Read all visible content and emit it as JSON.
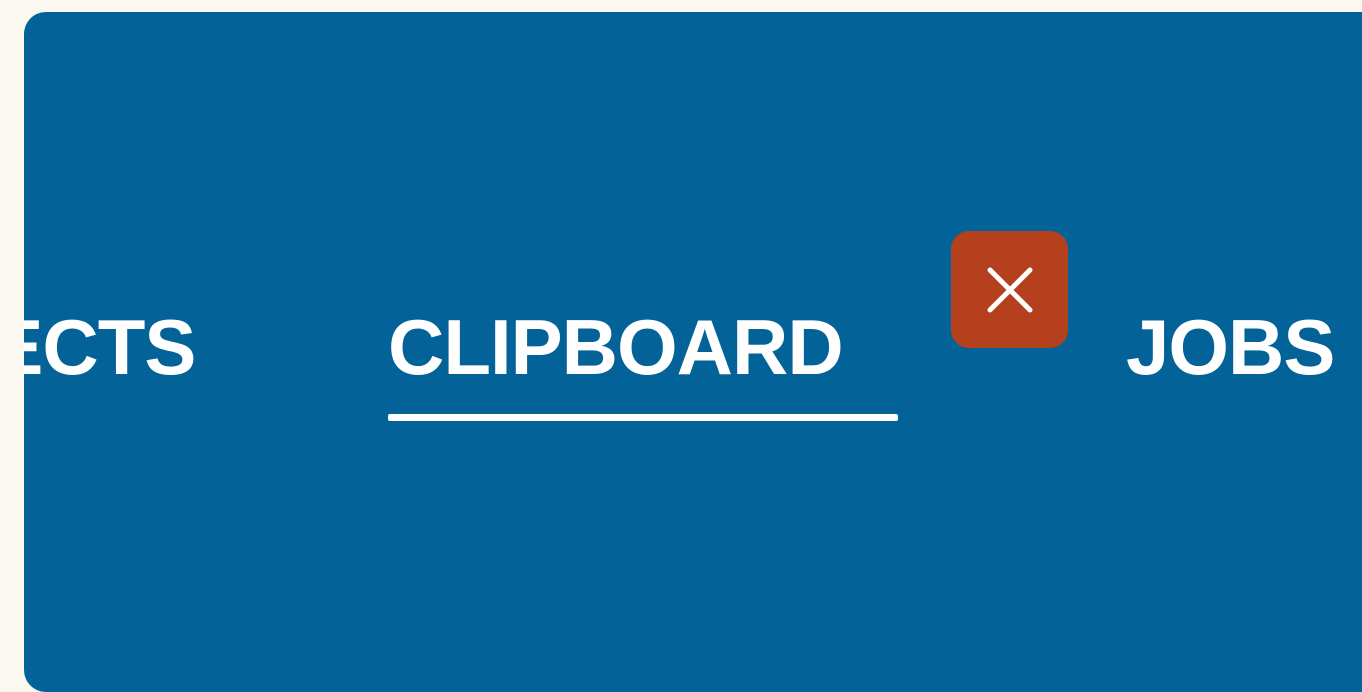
{
  "tabs": [
    {
      "label": "OBJECTS",
      "visible_label": "ECTS",
      "active": false
    },
    {
      "label": "CLIPBOARD",
      "active": true
    },
    {
      "label": "JOBS",
      "active": false
    }
  ],
  "close_button": {
    "icon": "close-icon"
  },
  "colors": {
    "page_background": "#fbf8f2",
    "panel_background": "#036298",
    "close_button": "#b5401e",
    "text": "#ffffff"
  }
}
